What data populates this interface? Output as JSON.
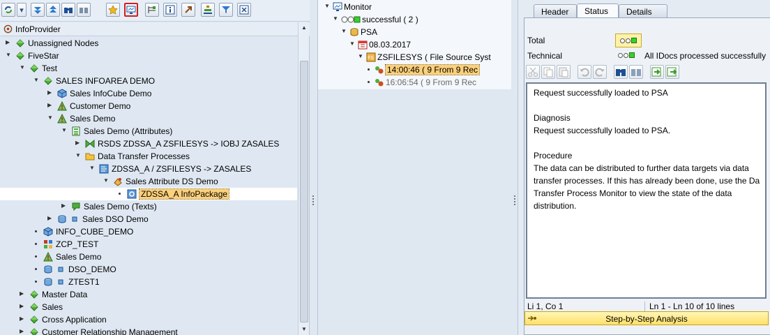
{
  "left_panel": {
    "header": "InfoProvider",
    "tree": [
      {
        "label": "Unassigned Nodes",
        "level": 0,
        "arrow": "right",
        "icon": "diamond-green-icon"
      },
      {
        "label": "FiveStar",
        "level": 0,
        "arrow": "down",
        "icon": "diamond-green-icon"
      },
      {
        "label": "Test",
        "level": 1,
        "arrow": "down",
        "icon": "diamond-green-icon"
      },
      {
        "label": "SALES INFOAREA DEMO",
        "level": 2,
        "arrow": "down",
        "icon": "diamond-green-icon"
      },
      {
        "label": "Sales InfoCube Demo",
        "level": 3,
        "arrow": "right",
        "icon": "cube-icon"
      },
      {
        "label": "Customer Demo",
        "level": 3,
        "arrow": "right",
        "icon": "triangle-infoobject-icon"
      },
      {
        "label": "Sales Demo",
        "level": 3,
        "arrow": "down",
        "icon": "triangle-infoobject-icon"
      },
      {
        "label": "Sales Demo (Attributes)",
        "level": 4,
        "arrow": "down",
        "icon": "attributes-icon"
      },
      {
        "label": "RSDS ZDSSA_A ZSFILESYS -> IOBJ ZASALES",
        "level": 5,
        "arrow": "right",
        "icon": "transformation-icon"
      },
      {
        "label": "Data Transfer Processes",
        "level": 5,
        "arrow": "down",
        "icon": "folder-icon"
      },
      {
        "label": "ZDSSA_A / ZSFILESYS -> ZASALES",
        "level": 6,
        "arrow": "down",
        "icon": "dtp-icon"
      },
      {
        "label": "Sales Attribute DS Demo",
        "level": 7,
        "arrow": "down",
        "icon": "datasource-icon"
      },
      {
        "label": "ZDSSA_A InfoPackage",
        "level": 8,
        "arrow": "bullet",
        "icon": "infopackage-icon",
        "selected": true
      },
      {
        "label": "Sales Demo (Texts)",
        "level": 4,
        "arrow": "right",
        "icon": "texts-icon"
      },
      {
        "label": "Sales DSO Demo",
        "level": 3,
        "arrow": "right",
        "icon": "dso-icon",
        "extra_icon": "small-square-icon"
      },
      {
        "label": "INFO_CUBE_DEMO",
        "level": 2,
        "arrow": "bullet",
        "icon": "cube-icon"
      },
      {
        "label": "ZCP_TEST",
        "level": 2,
        "arrow": "bullet",
        "icon": "multiprovider-icon"
      },
      {
        "label": "Sales Demo",
        "level": 2,
        "arrow": "bullet",
        "icon": "triangle-infoobject-icon"
      },
      {
        "label": "DSO_DEMO",
        "level": 2,
        "arrow": "bullet",
        "icon": "dso-icon",
        "extra_icon": "small-square-icon"
      },
      {
        "label": "ZTEST1",
        "level": 2,
        "arrow": "bullet",
        "icon": "dso-icon",
        "extra_icon": "small-square-icon"
      },
      {
        "label": "Master Data",
        "level": 1,
        "arrow": "right",
        "icon": "diamond-green-icon"
      },
      {
        "label": "Sales",
        "level": 1,
        "arrow": "right",
        "icon": "diamond-green-icon"
      },
      {
        "label": "Cross Application",
        "level": 1,
        "arrow": "right",
        "icon": "diamond-green-icon"
      },
      {
        "label": "Customer Relationship Management",
        "level": 1,
        "arrow": "right",
        "icon": "diamond-green-icon"
      }
    ]
  },
  "middle_panel": {
    "tree": [
      {
        "label": "Monitor",
        "level": 0,
        "arrow": "down",
        "icon": "monitor-icon"
      },
      {
        "label": "successful ( 2 )",
        "level": 1,
        "arrow": "down",
        "icon": "traffic-light-green-icon"
      },
      {
        "label": "PSA",
        "level": 2,
        "arrow": "down",
        "icon": "psa-icon"
      },
      {
        "label": "08.03.2017",
        "level": 3,
        "arrow": "down",
        "icon": "calendar-icon"
      },
      {
        "label": "ZSFILESYS ( File Source Syst",
        "level": 4,
        "arrow": "down",
        "icon": "source-system-icon"
      },
      {
        "label": "14:00:46 ( 9 From 9 Rec",
        "level": 5,
        "arrow": "bullet",
        "icon": "request-icon",
        "selected": true
      },
      {
        "label": "16:06:54 ( 9 From 9 Rec",
        "level": 5,
        "arrow": "bullet",
        "icon": "request-icon",
        "dim": true
      }
    ]
  },
  "right_panel": {
    "tabs": [
      {
        "label": "Header",
        "active": false
      },
      {
        "label": "Status",
        "active": true
      },
      {
        "label": "Details",
        "active": false
      }
    ],
    "total_label": "Total",
    "technical_label": "Technical",
    "technical_status": "All IDocs processed successfully",
    "text_lines": [
      "Request successfully loaded to PSA",
      "",
      "Diagnosis",
      "Request successfully loaded to PSA.",
      "",
      "Procedure",
      "The data can be distributed to further data targets via data",
      "transfer processes. If this has already been done, use the Da",
      "Transfer Process Monitor to view the state of the data",
      "distribution."
    ],
    "status_left": "Li 1, Co 1",
    "status_right": "Ln 1 - Ln 10 of 10 lines",
    "analysis_button": "Step-by-Step Analysis"
  },
  "colors": {
    "selection": "#fdd07a",
    "status_green": "#2dd52d",
    "panel_bg": "#dfe8f2",
    "analysis_bg": "#ffe067"
  }
}
